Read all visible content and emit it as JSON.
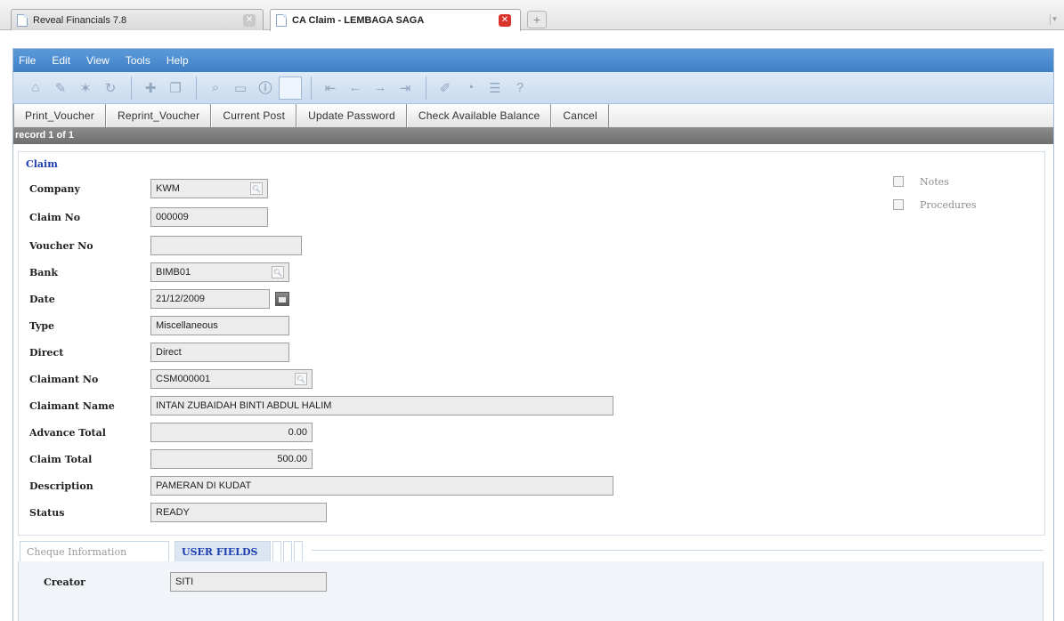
{
  "browser": {
    "tabs": [
      {
        "label": "Reveal Financials 7.8"
      },
      {
        "label": "CA Claim - LEMBAGA SAGA"
      }
    ],
    "new_tab": "+"
  },
  "menu": [
    "File",
    "Edit",
    "View",
    "Tools",
    "Help"
  ],
  "toolbar_icons": [
    "home-icon",
    "edit-icon",
    "star-icon",
    "refresh-icon",
    "add-icon",
    "copy-icon",
    "paste-icon",
    "search-icon",
    "print-icon",
    "info-icon",
    "view-icon",
    "first-icon",
    "prev-icon",
    "next-icon",
    "last-icon",
    "note-icon",
    "chart-icon",
    "filter-icon",
    "help-icon"
  ],
  "actions": [
    "Print_Voucher",
    "Reprint_Voucher",
    "Current Post",
    "Update Password",
    "Check Available Balance",
    "Cancel"
  ],
  "record": "record 1 of 1",
  "section": "Claim",
  "form": {
    "company": {
      "label": "Company",
      "value": "KWM"
    },
    "claim_no": {
      "label": "Claim No",
      "value": "000009"
    },
    "voucher_no": {
      "label": "Voucher No",
      "value": ""
    },
    "bank": {
      "label": "Bank",
      "value": "BIMB01"
    },
    "date": {
      "label": "Date",
      "value": "21/12/2009"
    },
    "type": {
      "label": "Type",
      "value": "Miscellaneous"
    },
    "direct": {
      "label": "Direct",
      "value": "Direct"
    },
    "claimant_no": {
      "label": "Claimant No",
      "value": "CSM000001"
    },
    "claimant_name": {
      "label": "Claimant Name",
      "value": "INTAN ZUBAIDAH BINTI ABDUL HALIM"
    },
    "advance_total": {
      "label": "Advance Total",
      "value": "0.00"
    },
    "claim_total": {
      "label": "Claim Total",
      "value": "500.00"
    },
    "description": {
      "label": "Description",
      "value": "PAMERAN DI KUDAT"
    },
    "status": {
      "label": "Status",
      "value": "READY"
    }
  },
  "side_checks": [
    {
      "label": "Notes",
      "checked": false
    },
    {
      "label": "Procedures",
      "checked": false
    }
  ],
  "bottom_tabs": [
    "Cheque Information",
    "USER FIELDS"
  ],
  "user_fields": {
    "creator": {
      "label": "Creator",
      "value": "SITI"
    }
  }
}
